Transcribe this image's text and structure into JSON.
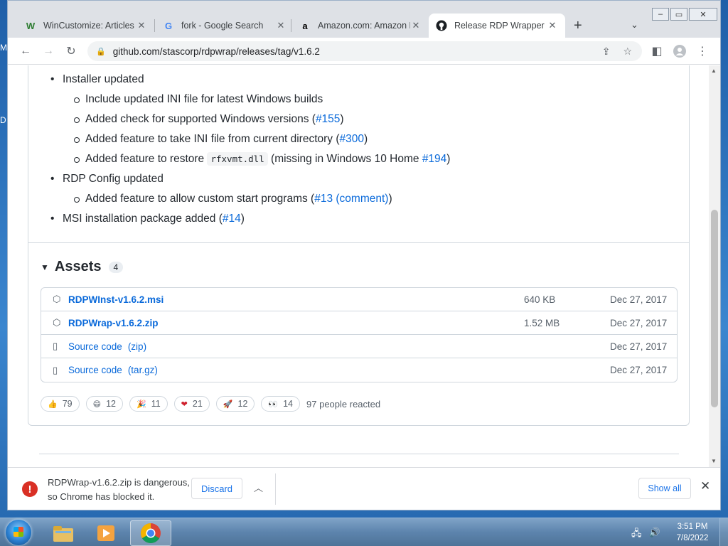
{
  "desktop": {
    "letters": [
      "M",
      "D"
    ]
  },
  "tabs": [
    {
      "title": "WinCustomize: Articles",
      "favicon": "W",
      "color": "#2e7d32"
    },
    {
      "title": "fork - Google Search",
      "favicon": "G",
      "color": "#4285f4"
    },
    {
      "title": "Amazon.com: Amazon E",
      "favicon": "a",
      "color": "#000000"
    },
    {
      "title": "Release RDP Wrapper Li",
      "favicon": "github-icon",
      "color": "#000000"
    }
  ],
  "address": {
    "url": "github.com/stascorp/rdpwrap/releases/tag/v1.6.2"
  },
  "notes": {
    "installer": "Installer updated",
    "ini": "Include updated INI file for latest Windows builds",
    "check_prefix": "Added check for supported Windows versions (",
    "check_link": "#155",
    "check_suffix": ")",
    "take_prefix": "Added feature to take INI file from current directory (",
    "take_link": "#300",
    "take_suffix": ")",
    "restore_prefix": "Added feature to restore ",
    "restore_code": "rfxvmt.dll",
    "restore_mid": " (missing in Windows 10 Home ",
    "restore_link": "#194",
    "restore_suffix": ")",
    "rdpconfig": "RDP Config updated",
    "custom_prefix": "Added feature to allow custom start programs (",
    "custom_link1": "#13",
    "custom_link2": "(comment)",
    "custom_suffix": ")",
    "msi_prefix": "MSI installation package added (",
    "msi_link": "#14",
    "msi_suffix": ")"
  },
  "assets": {
    "heading": "Assets",
    "count": "4",
    "items": [
      {
        "name": "RDPWInst-v1.6.2.msi",
        "sub": "",
        "size": "640 KB",
        "date": "Dec 27, 2017",
        "icon": "package-icon"
      },
      {
        "name": "RDPWrap-v1.6.2.zip",
        "sub": "",
        "size": "1.52 MB",
        "date": "Dec 27, 2017",
        "icon": "package-icon"
      },
      {
        "name": "Source code",
        "sub": "(zip)",
        "size": "",
        "date": "Dec 27, 2017",
        "icon": "file-zip-icon"
      },
      {
        "name": "Source code",
        "sub": "(tar.gz)",
        "size": "",
        "date": "Dec 27, 2017",
        "icon": "file-zip-icon"
      }
    ]
  },
  "reactions": {
    "items": [
      {
        "emoji": "👍",
        "count": "79"
      },
      {
        "emoji": "😄",
        "count": "12"
      },
      {
        "emoji": "🎉",
        "count": "11"
      },
      {
        "emoji": "❤",
        "count": "21"
      },
      {
        "emoji": "🚀",
        "count": "12"
      },
      {
        "emoji": "👀",
        "count": "14"
      }
    ],
    "summary": "97 people reacted"
  },
  "download": {
    "line1": "RDPWrap-v1.6.2.zip is dangerous,",
    "line2": "so Chrome has blocked it.",
    "discard": "Discard",
    "show_all": "Show all"
  },
  "taskbar": {
    "time": "3:51 PM",
    "date": "7/8/2022"
  }
}
